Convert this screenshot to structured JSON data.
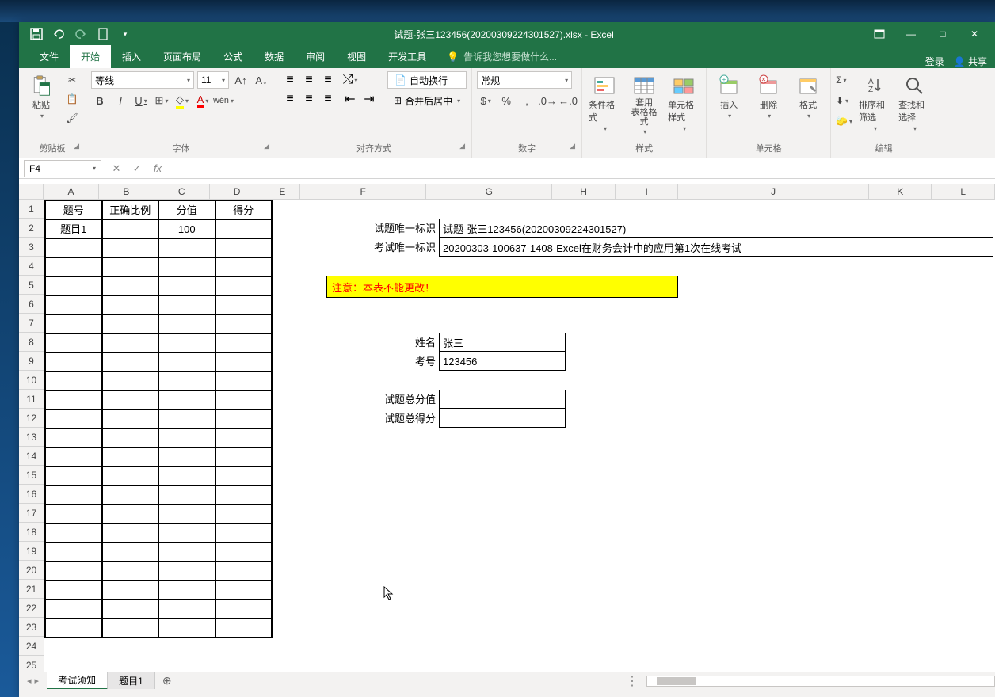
{
  "window": {
    "title": "试题-张三123456(20200309224301527).xlsx - Excel"
  },
  "qat": {
    "save": "save-icon",
    "undo": "undo-icon",
    "redo": "redo-icon",
    "new": "new-file-icon"
  },
  "win_controls": {
    "ribbon_options": "⌃",
    "minimize": "—",
    "maximize": "□",
    "close": "✕"
  },
  "ribbon_tabs": {
    "file": "文件",
    "home": "开始",
    "insert": "插入",
    "layout": "页面布局",
    "formulas": "公式",
    "data": "数据",
    "review": "审阅",
    "view": "视图",
    "developer": "开发工具",
    "tellme_icon": "💡",
    "tellme": "告诉我您想要做什么...",
    "login": "登录",
    "share": "共享"
  },
  "ribbon": {
    "clipboard": {
      "paste": "粘贴",
      "label": "剪贴板"
    },
    "font": {
      "name": "等线",
      "size": "11",
      "label": "字体"
    },
    "alignment": {
      "wrap": "自动换行",
      "merge": "合并后居中",
      "label": "对齐方式"
    },
    "number": {
      "format": "常规",
      "label": "数字"
    },
    "styles": {
      "conditional": "条件格式",
      "table": "套用\n表格格式",
      "cell": "单元格样式",
      "label": "样式"
    },
    "cells": {
      "insert": "插入",
      "delete": "删除",
      "format": "格式",
      "label": "单元格"
    },
    "editing": {
      "sort": "排序和筛选",
      "find": "查找和选择",
      "label": "编辑"
    }
  },
  "formula_bar": {
    "name_box": "F4",
    "cancel": "✕",
    "enter": "✓",
    "fx": "fx"
  },
  "columns": [
    "A",
    "B",
    "C",
    "D",
    "E",
    "F",
    "G",
    "H",
    "I",
    "J",
    "K",
    "L"
  ],
  "left_table": {
    "headers": [
      "题号",
      "正确比例",
      "分值",
      "得分"
    ],
    "row2": {
      "a": "题目1",
      "c": "100"
    },
    "rows": 23
  },
  "fields": {
    "q_id_label": "试题唯一标识",
    "q_id_value": "试题-张三123456(20200309224301527)",
    "exam_id_label": "考试唯一标识",
    "exam_id_value": "20200303-100637-1408-Excel在财务会计中的应用第1次在线考试",
    "warn": "注意：本表不能更改！",
    "name_label": "姓名",
    "name_value": "张三",
    "id_label": "考号",
    "id_value": "123456",
    "total_score_label": "试题总分值",
    "total_got_label": "试题总得分"
  },
  "sheet_tabs": {
    "tab1": "考试须知",
    "tab2": "题目1",
    "add": "⊕"
  }
}
